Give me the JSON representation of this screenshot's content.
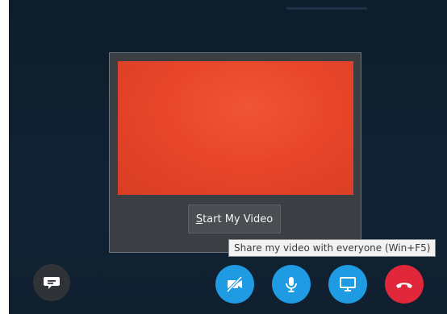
{
  "preview": {
    "start_video_label_prefix": "S",
    "start_video_label_rest": "tart My Video"
  },
  "tooltip": {
    "text": "Share my video with everyone (Win+F5)"
  },
  "controls": [
    {
      "name": "chat",
      "icon": "chat-bubble-icon"
    },
    {
      "name": "video",
      "icon": "video-off-icon",
      "state": "off"
    },
    {
      "name": "mic",
      "icon": "microphone-icon"
    },
    {
      "name": "share-screen",
      "icon": "monitor-icon"
    },
    {
      "name": "hang-up",
      "icon": "phone-hangup-icon"
    }
  ],
  "colors": {
    "call_background": "#112233",
    "control_blue": "#1f9be3",
    "hangup_red": "#e0283a",
    "preview_red": "#e8462a"
  }
}
